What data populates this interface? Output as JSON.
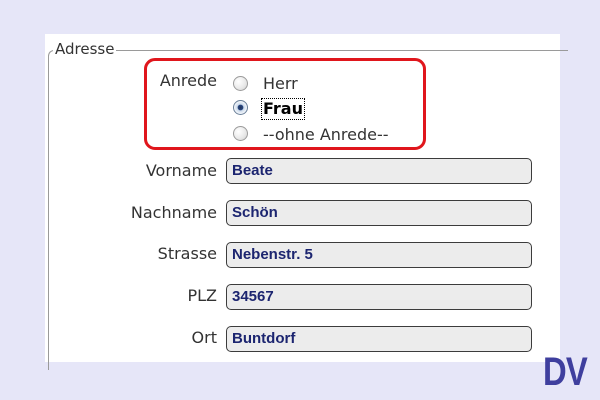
{
  "form": {
    "legend": "Adresse",
    "salutation": {
      "label": "Anrede",
      "options": [
        {
          "label": "Herr",
          "selected": false
        },
        {
          "label": "Frau",
          "selected": true
        },
        {
          "label": "--ohne Anrede--",
          "selected": false
        }
      ]
    },
    "fields": [
      {
        "label": "Vorname",
        "value": "Beate"
      },
      {
        "label": "Nachname",
        "value": "Schön"
      },
      {
        "label": "Strasse",
        "value": "Nebenstr. 5"
      },
      {
        "label": "PLZ",
        "value": "34567"
      },
      {
        "label": "Ort",
        "value": "Buntdorf"
      }
    ]
  },
  "highlight_color": "#e0161c",
  "logo": {
    "text": "DV",
    "color": "#3f3f9e"
  }
}
